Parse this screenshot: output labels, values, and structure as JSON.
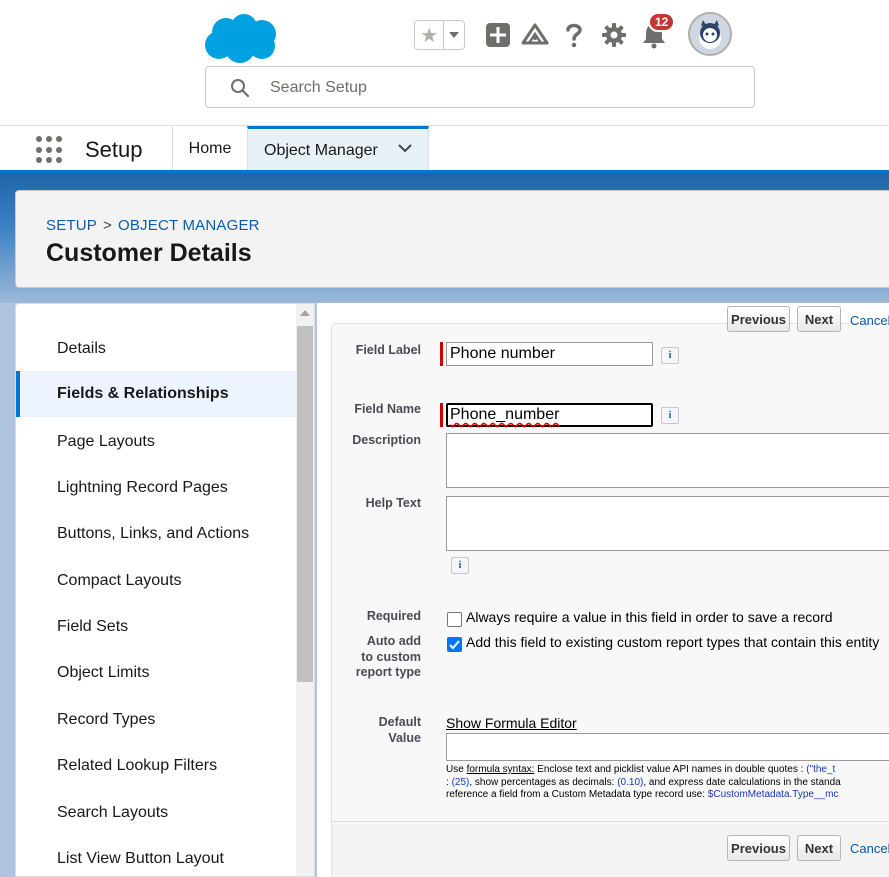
{
  "header": {
    "search_placeholder": "Search Setup",
    "notification_count": "12",
    "colors": {
      "brand": "#00A1E0",
      "accent": "#0176D3"
    },
    "icons": [
      "salesforce-cloud-logo",
      "star-icon",
      "chevron-down-icon",
      "plus-icon",
      "trailhead-icon",
      "help-icon",
      "gear-icon",
      "bell-icon",
      "avatar"
    ]
  },
  "nav": {
    "app_name": "Setup",
    "home": "Home",
    "object_manager": "Object Manager"
  },
  "object_header": {
    "breadcrumb_setup": "SETUP",
    "breadcrumb_sep": ">",
    "breadcrumb_om": "OBJECT MANAGER",
    "title": "Customer Details"
  },
  "sidebar": {
    "items": [
      {
        "label": "Details"
      },
      {
        "label": "Fields & Relationships"
      },
      {
        "label": "Page Layouts"
      },
      {
        "label": "Lightning Record Pages"
      },
      {
        "label": "Buttons, Links, and Actions"
      },
      {
        "label": "Compact Layouts"
      },
      {
        "label": "Field Sets"
      },
      {
        "label": "Object Limits"
      },
      {
        "label": "Record Types"
      },
      {
        "label": "Related Lookup Filters"
      },
      {
        "label": "Search Layouts"
      },
      {
        "label": "List View Button Layout"
      }
    ],
    "active_index": 1
  },
  "form": {
    "previous": "Previous",
    "next": "Next",
    "cancel": "Cancel",
    "field_label_label": "Field Label",
    "field_label_value": "Phone number",
    "field_name_label": "Field Name",
    "field_name_value": "Phone_number",
    "description_label": "Description",
    "help_text_label": "Help Text",
    "info": "i",
    "required_label": "Required",
    "required_text": "Always require a value in this field in order to save a record",
    "required_checked": false,
    "auto_add_label_1": "Auto add",
    "auto_add_label_2": "to custom",
    "auto_add_label_3": "report type",
    "auto_add_text": "Add this field to existing custom report types that contain this entity",
    "auto_add_checked": true,
    "default_value_label_1": "Default",
    "default_value_label_2": "Value",
    "show_formula_editor": "Show Formula Editor",
    "help_line1_a": "Use ",
    "help_line1_link": "formula syntax:",
    "help_line1_b": " Enclose text and picklist value API names in double quotes : ",
    "help_line1_c": "(\"the_t",
    "help_line2_a": ": ",
    "help_line2_b": "(25)",
    "help_line2_c": ", show percentages as decimals: ",
    "help_line2_d": "(0.10)",
    "help_line2_e": ", and express date calculations in the standa",
    "help_line3_a": "reference a field from a Custom Metadata type record use: ",
    "help_line3_b": "$CustomMetadata.Type__mc"
  }
}
